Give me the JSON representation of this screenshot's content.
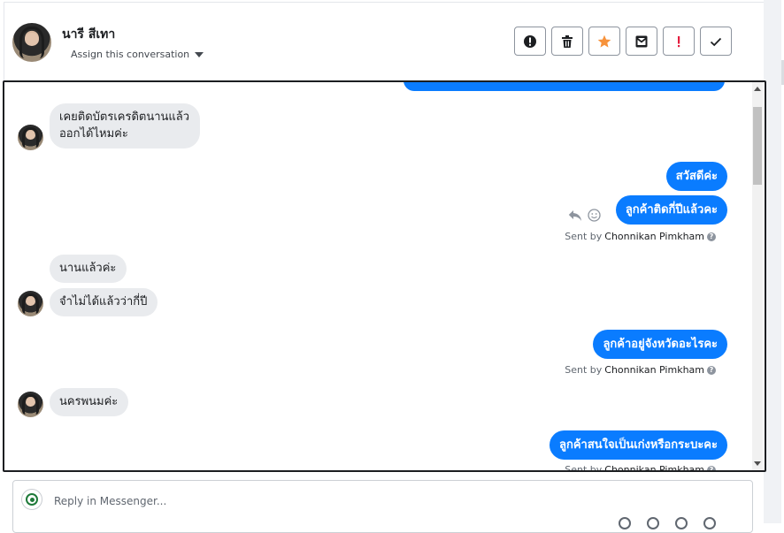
{
  "header": {
    "contact_name": "นารี สีเทา",
    "assign_label": "Assign this conversation",
    "toolbar": [
      {
        "name": "spam-button",
        "icon": "exclamation-circle-icon"
      },
      {
        "name": "delete-button",
        "icon": "trash-icon"
      },
      {
        "name": "star-button",
        "icon": "star-icon",
        "color": "#f7923b"
      },
      {
        "name": "mark-unread-button",
        "icon": "envelope-icon"
      },
      {
        "name": "follow-up-button",
        "icon": "exclamation-icon",
        "color": "#e41e3f"
      },
      {
        "name": "mark-done-button",
        "icon": "checkmark-icon"
      }
    ]
  },
  "conversation": {
    "incoming": [
      {
        "lines": [
          "เคยติดบัตรเครดิตนานแล้ว",
          "ออกได้ไหมค่ะ"
        ]
      },
      {
        "text": "นานแล้วค่ะ"
      },
      {
        "text": "จำไม่ได้แล้วว่ากี่ปี"
      },
      {
        "text": "นครพนมค่ะ"
      }
    ],
    "outgoing": [
      {
        "text": "สวัสดีค่ะ"
      },
      {
        "text": "ลูกค้าติดกี่ปีแล้วคะ"
      },
      {
        "text": "ลูกค้าอยู่จังหวัดอะไรคะ"
      },
      {
        "text": "ลูกค้าสนใจเป็นเก่งหรือกระบะคะ"
      }
    ],
    "sent_by_prefix": "Sent by",
    "sender_name": "Chonnikan Pimkham",
    "help_glyph": "?"
  },
  "reply": {
    "placeholder": "Reply in Messenger..."
  },
  "colors": {
    "outgoing_bubble": "#0a7cff",
    "incoming_bubble": "#e9ebee",
    "star": "#f7923b",
    "follow_up": "#e41e3f"
  }
}
